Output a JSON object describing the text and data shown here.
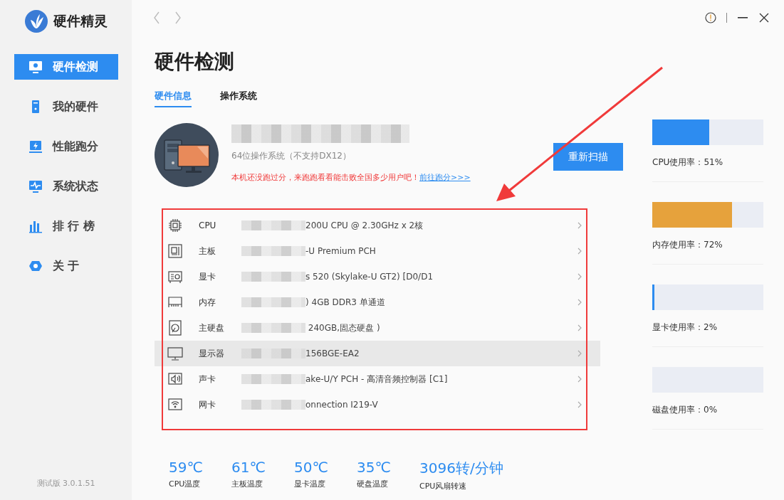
{
  "app": {
    "name": "硬件精灵",
    "version": "测试版 3.0.1.51"
  },
  "sidebar": {
    "items": [
      {
        "label": "硬件检测",
        "selected": true
      },
      {
        "label": "我的硬件",
        "selected": false
      },
      {
        "label": "性能跑分",
        "selected": false
      },
      {
        "label": "系统状态",
        "selected": false
      },
      {
        "label": "排 行 榜",
        "selected": false
      },
      {
        "label": "关 于",
        "selected": false
      }
    ]
  },
  "page": {
    "title": "硬件检测"
  },
  "tabs": [
    {
      "label": "硬件信息",
      "selected": true
    },
    {
      "label": "操作系统",
      "selected": false
    }
  ],
  "summary": {
    "os": "64位操作系统（不支持DX12）",
    "prompt": "本机还没跑过分，来跑跑看看能击败全国多少用户吧！",
    "link": "前往跑分>>>",
    "button": "重新扫描"
  },
  "devices": [
    {
      "label": "CPU",
      "value": "200U CPU @ 2.30GHz x 2核",
      "selected": false
    },
    {
      "label": "主板",
      "value": "-U Premium PCH",
      "selected": false
    },
    {
      "label": "显卡",
      "value": "s 520 (Skylake-U GT2) [D0/D1",
      "selected": false
    },
    {
      "label": "内存",
      "value": ") 4GB DDR3 单通道",
      "selected": false
    },
    {
      "label": "主硬盘",
      "value": " 240GB,固态硬盘 )",
      "selected": false
    },
    {
      "label": "显示器",
      "value": "156BGE-EA2",
      "selected": true
    },
    {
      "label": "声卡",
      "value": "ake-U/Y PCH - 高清音频控制器 [C1]",
      "selected": false
    },
    {
      "label": "网卡",
      "value": "onnection I219-V",
      "selected": false
    }
  ],
  "temperatures": [
    {
      "value": "59℃",
      "label": "CPU温度"
    },
    {
      "value": "61℃",
      "label": "主板温度"
    },
    {
      "value": "50℃",
      "label": "显卡温度"
    },
    {
      "value": "35℃",
      "label": "硬盘温度"
    },
    {
      "value": "3096转/分钟",
      "label": "CPU风扇转速"
    }
  ],
  "usage": [
    {
      "label": "CPU使用率：51%",
      "level": 0.51,
      "color": "#2d8cf0"
    },
    {
      "label": "内存使用率：72%",
      "level": 0.72,
      "color": "#e6a23c"
    },
    {
      "label": "显卡使用率：2%",
      "level": 0.02,
      "color": "#2d8cf0"
    },
    {
      "label": "磁盘使用率：0%"
    }
  ]
}
